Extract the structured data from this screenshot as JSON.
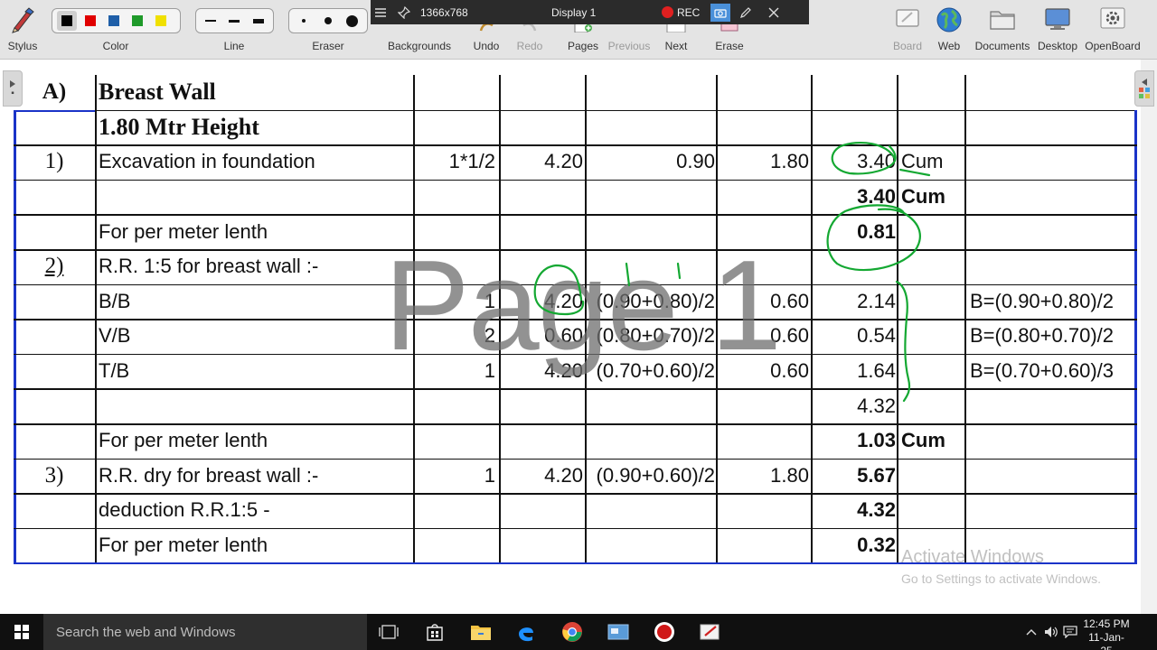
{
  "toolbar": {
    "stylus_label": "Stylus",
    "color_label": "Color",
    "line_label": "Line",
    "eraser_label": "Eraser",
    "backgrounds_label": "Backgrounds",
    "undo_label": "Undo",
    "redo_label": "Redo",
    "pages_label": "Pages",
    "previous_label": "Previous",
    "next_label": "Next",
    "erase_label": "Erase",
    "board_label": "Board",
    "web_label": "Web",
    "documents_label": "Documents",
    "desktop_label": "Desktop",
    "openboard_label": "OpenBoard",
    "colors": [
      "#000000",
      "#e00000",
      "#1f5fa8",
      "#1f9a2a",
      "#f0e000"
    ],
    "selected_color_index": 0
  },
  "display_bar": {
    "resolution": "1366x768",
    "display_name": "Display 1",
    "rec_label": "REC"
  },
  "document": {
    "watermark": "Page 1",
    "rows": [
      {
        "no": "A)",
        "desc": "Breast Wall",
        "heading": true
      },
      {
        "no": "",
        "desc": "1.80 Mtr Height",
        "heading": true
      },
      {
        "no": "1)",
        "desc": "Excavation in foundation",
        "n": "1*1/2",
        "l": "4.20",
        "b": "0.90",
        "h": "1.80",
        "q": "3.40",
        "unit": "Cum"
      },
      {
        "no": "",
        "desc": "",
        "q": "3.40",
        "unit": "Cum",
        "bold": true
      },
      {
        "no": "",
        "desc": "For per meter lenth",
        "q": "0.81",
        "bold": true
      },
      {
        "no": "2)",
        "desc": "R.R. 1:5 for breast wall :-",
        "underline_no": true
      },
      {
        "no": "",
        "desc": "B/B",
        "n": "1",
        "l": "4.20",
        "b": "(0.90+0.80)/2",
        "h": "0.60",
        "q": "2.14",
        "remark": "B=(0.90+0.80)/2"
      },
      {
        "no": "",
        "desc": "V/B",
        "n": "2",
        "l": "0.60",
        "b": "(0.80+0.70)/2",
        "h": "0.60",
        "q": "0.54",
        "remark": "B=(0.80+0.70)/2"
      },
      {
        "no": "",
        "desc": "T/B",
        "n": "1",
        "l": "4.20",
        "b": "(0.70+0.60)/2",
        "h": "0.60",
        "q": "1.64",
        "remark": "B=(0.70+0.60)/3"
      },
      {
        "no": "",
        "desc": "",
        "q": "4.32"
      },
      {
        "no": "",
        "desc": "For per meter lenth",
        "q": "1.03",
        "unit": "Cum",
        "bold": true
      },
      {
        "no": "3)",
        "desc": "R.R. dry for breast wall :-",
        "n": "1",
        "l": "4.20",
        "b": "(0.90+0.60)/2",
        "h": "1.80",
        "q": "5.67",
        "bold": true
      },
      {
        "no": "",
        "desc": "deduction R.R.1:5 -",
        "q": "4.32",
        "bold": true
      },
      {
        "no": "",
        "desc": "For per meter lenth",
        "q": "0.32",
        "bold": true
      }
    ]
  },
  "activation": {
    "title": "Activate Windows",
    "subtitle": "Go to Settings to activate Windows."
  },
  "taskbar": {
    "search_placeholder": "Search the web and Windows",
    "time": "12:45 PM",
    "date": "11-Jan-25"
  }
}
